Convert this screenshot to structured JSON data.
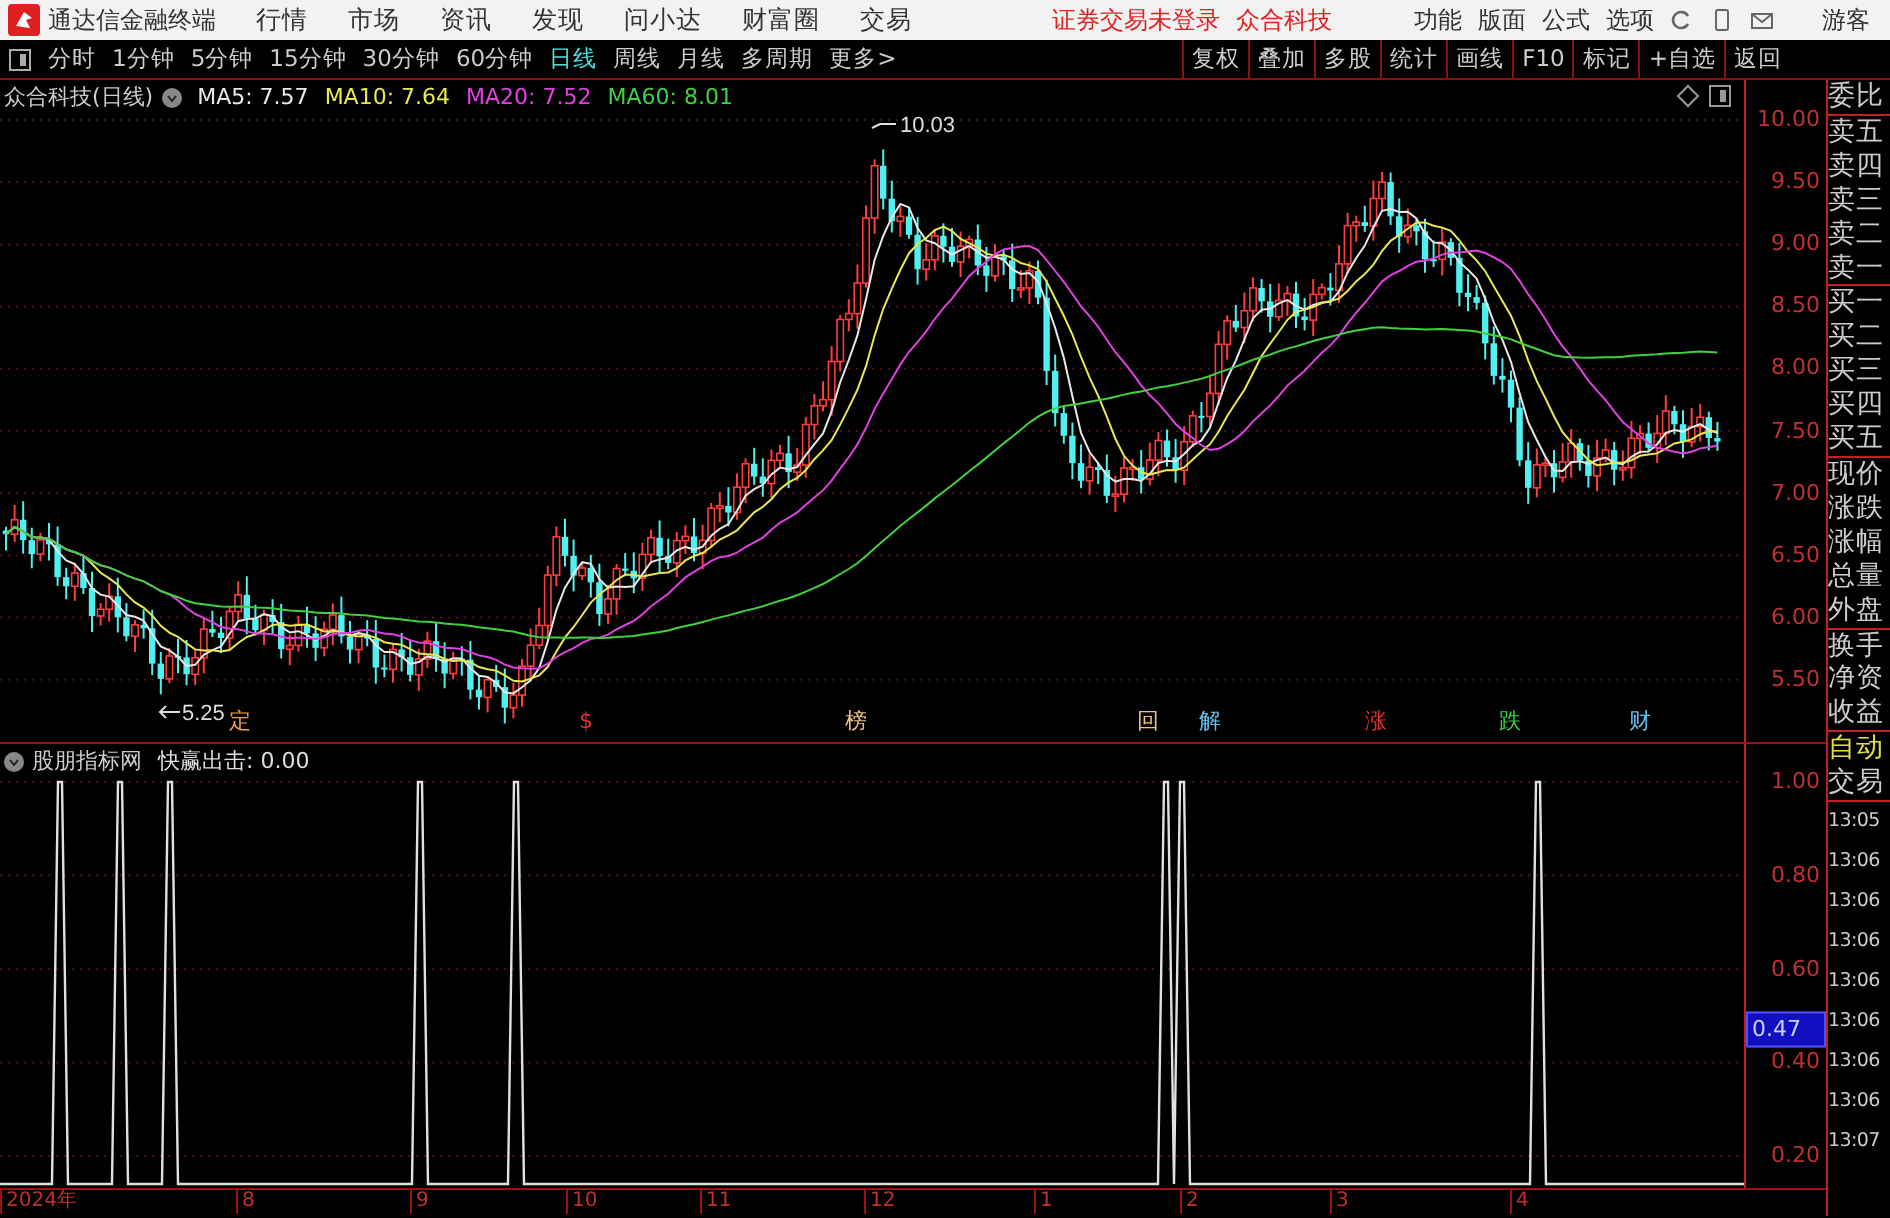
{
  "app": {
    "title": "通达信金融终端",
    "menu": [
      "行情",
      "市场",
      "资讯",
      "发现",
      "问小达",
      "财富圈",
      "交易"
    ],
    "status": "证券交易未登录",
    "stock": "众合科技",
    "right_menu": [
      "功能",
      "版面",
      "公式",
      "选项"
    ],
    "user": "游客"
  },
  "periods": [
    {
      "label": "分时",
      "selected": false
    },
    {
      "label": "1分钟",
      "selected": false
    },
    {
      "label": "5分钟",
      "selected": false
    },
    {
      "label": "15分钟",
      "selected": false
    },
    {
      "label": "30分钟",
      "selected": false
    },
    {
      "label": "60分钟",
      "selected": false
    },
    {
      "label": "日线",
      "selected": true
    },
    {
      "label": "周线",
      "selected": false
    },
    {
      "label": "月线",
      "selected": false
    },
    {
      "label": "多周期",
      "selected": false
    },
    {
      "label": "更多>",
      "selected": false
    }
  ],
  "tools": [
    "复权",
    "叠加",
    "多股",
    "统计",
    "画线",
    "F10",
    "标记",
    "+自选",
    "返回"
  ],
  "price_chart": {
    "title": "众合科技(日线)",
    "ma": [
      {
        "label": "MA5: 7.57",
        "color": "#e8e8e8"
      },
      {
        "label": "MA10: 7.64",
        "color": "#e8e850"
      },
      {
        "label": "MA20: 7.52",
        "color": "#e040e0"
      },
      {
        "label": "MA60: 8.01",
        "color": "#40d040"
      }
    ],
    "y_ticks": [
      "10.00",
      "9.50",
      "9.00",
      "8.50",
      "8.00",
      "7.50",
      "7.00",
      "6.50",
      "6.00",
      "5.50"
    ],
    "high_label": "10.03",
    "low_label": "5.25",
    "events": [
      {
        "text": "定",
        "color": "#f0a050"
      },
      {
        "text": "$",
        "color": "#e03030"
      },
      {
        "text": "榜",
        "color": "#f0c080"
      },
      {
        "text": "回",
        "color": "#f0c080"
      },
      {
        "text": "解",
        "color": "#60c0f0"
      },
      {
        "text": "涨",
        "color": "#e03030"
      },
      {
        "text": "跌",
        "color": "#40d040"
      },
      {
        "text": "财",
        "color": "#60c0f0"
      }
    ]
  },
  "indicator": {
    "name": "股朋指标网",
    "value": "快赢出击: 0.00",
    "y_ticks": [
      "1.00",
      "0.80",
      "0.60",
      "0.40",
      "0.20"
    ],
    "cursor_value": "0.47"
  },
  "x_axis": [
    "2024年",
    "8",
    "9",
    "10",
    "11",
    "12",
    "1",
    "2",
    "3",
    "4"
  ],
  "side_panel": {
    "labels": [
      "委比",
      "卖五",
      "卖四",
      "卖三",
      "卖二",
      "卖一",
      "买一",
      "买二",
      "买三",
      "买四",
      "买五",
      "现价",
      "涨跌",
      "涨幅",
      "总量",
      "外盘",
      "换手",
      "净资",
      "收益"
    ],
    "auto": "自动",
    "trade": "交易",
    "times": [
      "13:05",
      "13:06",
      "13:06",
      "13:06",
      "13:06",
      "13:06",
      "13:06",
      "13:06",
      "13:07"
    ]
  }
}
